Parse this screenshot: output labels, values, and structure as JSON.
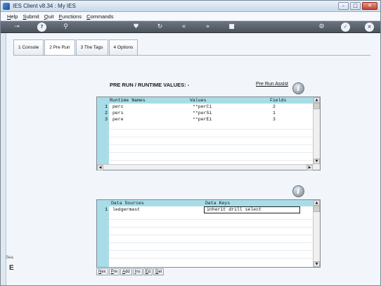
{
  "window": {
    "title": "IES Client v8.34 : My IES",
    "minimize": "–",
    "maximize": "□",
    "close": "✕"
  },
  "menu": [
    "Help",
    "Submit",
    "Quit",
    "Functions",
    "Commands"
  ],
  "toolbar": {
    "left_glyphs": [
      "⊸",
      "?",
      "⚲"
    ],
    "center_glyphs": [
      "♥",
      "↻",
      "«",
      "»",
      "■"
    ],
    "right_glyphs": [
      "⚙",
      "✓",
      "×"
    ]
  },
  "sidebar": {
    "label": "Sea",
    "glyph": "E"
  },
  "tabs": [
    {
      "label": "1 Console",
      "active": false
    },
    {
      "label": "2 Pre Run",
      "active": true
    },
    {
      "label": "3 The Tags",
      "active": false
    },
    {
      "label": "4 Options",
      "active": false
    }
  ],
  "runtime_section": {
    "title": "PRE RUN / RUNTIME VALUES: -",
    "assist_link": "Pre Run Assist",
    "info_glyph": "i"
  },
  "runtime_grid": {
    "headers": [
      "Runtime Names",
      "Values",
      "Fields"
    ],
    "rows": [
      {
        "num": "1",
        "name": "perc",
        "value": "**perCi",
        "field": "2"
      },
      {
        "num": "2",
        "name": "pers",
        "value": "**perSi",
        "field": "1"
      },
      {
        "num": "3",
        "name": "pere",
        "value": "**perEi",
        "field": "3"
      }
    ]
  },
  "sources_section": {
    "info_glyph": "i"
  },
  "sources_grid": {
    "headers": [
      "Data Sources",
      "Data Keys"
    ],
    "rows": [
      {
        "num": "1",
        "source": "ledgermast",
        "key": "inherit drill select"
      }
    ]
  },
  "grid_buttons": [
    "Nex",
    "Pre",
    "Add",
    "Ins",
    "Ed",
    "Del"
  ]
}
